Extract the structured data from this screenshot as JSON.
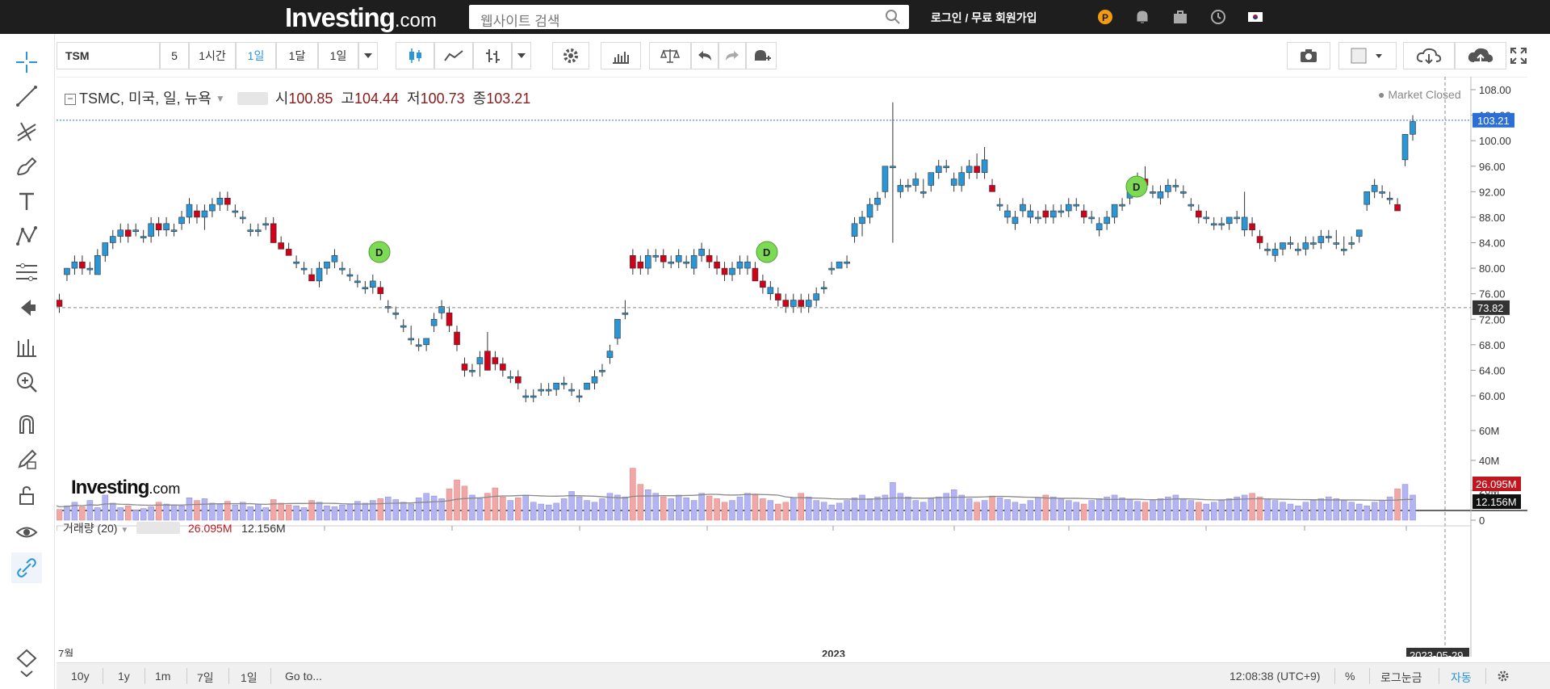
{
  "header": {
    "logo_main": "Investing",
    "logo_suffix": ".com",
    "search_placeholder": "웹사이트 검색",
    "login_text": "로그인 / 무료 회원가입",
    "icons": [
      "pro-icon",
      "bell-icon",
      "briefcase-icon",
      "clock-icon",
      "korea-flag-icon"
    ]
  },
  "left_tools": [
    "crosshair-icon",
    "trendline-icon",
    "pitchfork-icon",
    "brush-icon",
    "text-icon",
    "pattern-icon",
    "fib-icon",
    "back-arrow-icon",
    "measure-icon",
    "zoom-in-icon",
    "magnet-icon",
    "lock-pencil-icon",
    "unlock-icon",
    "eye-icon",
    "link-icon",
    "collapse-icon"
  ],
  "toolbar": {
    "symbol": "TSM",
    "intervals": [
      "5",
      "1시간",
      "1일",
      "1달",
      "1일"
    ],
    "active_interval": "1일"
  },
  "legend": {
    "title": "TSMC, 미국, 일, 뉴욕",
    "open_label": "시",
    "open": "100.85",
    "high_label": "고",
    "high": "104.44",
    "low_label": "저",
    "low": "100.73",
    "close_label": "종",
    "close": "103.21",
    "market_status": "Market Closed"
  },
  "volume_legend": {
    "label": "거래량 (20)",
    "value": "26.095M",
    "ma_value": "12.156M"
  },
  "watermark": {
    "main": "Investing",
    "suffix": ".com"
  },
  "chart_data": {
    "type": "candlestick",
    "price_axis": [
      "108.00",
      "104.00",
      "100.00",
      "96.00",
      "92.00",
      "88.00",
      "84.00",
      "80.00",
      "76.00",
      "72.00",
      "68.00",
      "64.00",
      "60.00"
    ],
    "price_badges": [
      "103.21",
      "73.82"
    ],
    "volume_axis": [
      "60M",
      "40M",
      "20M",
      "0"
    ],
    "volume_badges": [
      "26.095M",
      "12.156M"
    ],
    "x_labels": [
      "7월",
      "2023"
    ],
    "crosshair_date": "2023-05-29",
    "dividend_marker": "D",
    "candles": [
      [
        79,
        81,
        77,
        81
      ],
      [
        75,
        76,
        73,
        74
      ],
      [
        79,
        80,
        78,
        80
      ],
      [
        80,
        82,
        79,
        81
      ],
      [
        81,
        82,
        79,
        80
      ],
      [
        80,
        81,
        79,
        80
      ],
      [
        79,
        83,
        79,
        82
      ],
      [
        82,
        84,
        81,
        84
      ],
      [
        84,
        86,
        83,
        85
      ],
      [
        85,
        87,
        84,
        86
      ],
      [
        86,
        87,
        84,
        85
      ],
      [
        86,
        87,
        85,
        86
      ],
      [
        85,
        86,
        84,
        85
      ],
      [
        85,
        88,
        84,
        87
      ],
      [
        87,
        88,
        85,
        86
      ],
      [
        86,
        88,
        85,
        87
      ],
      [
        86,
        87,
        85,
        86
      ],
      [
        87,
        89,
        86,
        88
      ],
      [
        88,
        91,
        87,
        90
      ],
      [
        89,
        90,
        87,
        88
      ],
      [
        88,
        90,
        86,
        89
      ],
      [
        89,
        91,
        88,
        90
      ],
      [
        90,
        92,
        89,
        91
      ],
      [
        91,
        92,
        89,
        90
      ],
      [
        89,
        90,
        88,
        89
      ],
      [
        88,
        89,
        87,
        88
      ],
      [
        86,
        87,
        85,
        86
      ],
      [
        86,
        87,
        85,
        86
      ],
      [
        87,
        88,
        86,
        87
      ],
      [
        87,
        88,
        84,
        84
      ],
      [
        84,
        85,
        83,
        83
      ],
      [
        83,
        84,
        82,
        82
      ],
      [
        81,
        82,
        80,
        81
      ],
      [
        80,
        81,
        79,
        80
      ],
      [
        79,
        80,
        78,
        78
      ],
      [
        78,
        81,
        77,
        80
      ],
      [
        80,
        81,
        79,
        81
      ],
      [
        81,
        83,
        80,
        82
      ],
      [
        80,
        81,
        79,
        80
      ],
      [
        79,
        80,
        78,
        79
      ],
      [
        78,
        79,
        77,
        78
      ],
      [
        77,
        78,
        76,
        77
      ],
      [
        77,
        79,
        76,
        78
      ],
      [
        77,
        78,
        75,
        76
      ],
      [
        74,
        75,
        73,
        74
      ],
      [
        73,
        74,
        72,
        73
      ],
      [
        71,
        72,
        70,
        71
      ],
      [
        69,
        71,
        68,
        69
      ],
      [
        68,
        69,
        67,
        68
      ],
      [
        68,
        69,
        67,
        69
      ],
      [
        71,
        73,
        70,
        72
      ],
      [
        73,
        75,
        72,
        74
      ],
      [
        73,
        74,
        70,
        71
      ],
      [
        70,
        71,
        67,
        68
      ],
      [
        65,
        66,
        63,
        64
      ],
      [
        64,
        65,
        63,
        64
      ],
      [
        65,
        67,
        63,
        66
      ],
      [
        67,
        70,
        64,
        64
      ],
      [
        66,
        67,
        64,
        65
      ],
      [
        65,
        66,
        63,
        64
      ],
      [
        63,
        64,
        62,
        63
      ],
      [
        63,
        64,
        61,
        62
      ],
      [
        60,
        61,
        59,
        60
      ],
      [
        60,
        61,
        59,
        60
      ],
      [
        61,
        62,
        60,
        61
      ],
      [
        61,
        62,
        60,
        61
      ],
      [
        61,
        62,
        60,
        62
      ],
      [
        62,
        63,
        61,
        62
      ],
      [
        61,
        62,
        60,
        61
      ],
      [
        60,
        61,
        59,
        60
      ],
      [
        61,
        62,
        61,
        62
      ],
      [
        62,
        64,
        61,
        63
      ],
      [
        64,
        65,
        63,
        64
      ],
      [
        66,
        68,
        65,
        67
      ],
      [
        69,
        72,
        68,
        72
      ],
      [
        73,
        75,
        72,
        73
      ],
      [
        82,
        83,
        79,
        80
      ],
      [
        81,
        82,
        79,
        80
      ],
      [
        80,
        83,
        79,
        82
      ],
      [
        82,
        83,
        81,
        82
      ],
      [
        82,
        83,
        80,
        81
      ],
      [
        81,
        82,
        80,
        81
      ],
      [
        81,
        83,
        80,
        82
      ],
      [
        81,
        82,
        80,
        81
      ],
      [
        80,
        83,
        79,
        82
      ],
      [
        82,
        84,
        81,
        83
      ],
      [
        82,
        83,
        80,
        81
      ],
      [
        81,
        82,
        79,
        80
      ],
      [
        80,
        81,
        78,
        79
      ],
      [
        79,
        81,
        78,
        80
      ],
      [
        80,
        82,
        79,
        81
      ],
      [
        80,
        82,
        79,
        81
      ],
      [
        80,
        81,
        78,
        78
      ],
      [
        78,
        79,
        76,
        77
      ],
      [
        76,
        78,
        75,
        77
      ],
      [
        76,
        77,
        74,
        75
      ],
      [
        75,
        76,
        73,
        74
      ],
      [
        74,
        76,
        73,
        75
      ],
      [
        75,
        76,
        73,
        74
      ],
      [
        74,
        76,
        73,
        75
      ],
      [
        75,
        77,
        74,
        76
      ],
      [
        77,
        78,
        76,
        77
      ],
      [
        80,
        81,
        79,
        80
      ],
      [
        80,
        81,
        80,
        81
      ],
      [
        81,
        82,
        80,
        81
      ],
      [
        85,
        88,
        84,
        87
      ],
      [
        87,
        89,
        85,
        88
      ],
      [
        88,
        91,
        87,
        90
      ],
      [
        90,
        92,
        89,
        91
      ],
      [
        92,
        95,
        91,
        96
      ],
      [
        96,
        106,
        84,
        96
      ],
      [
        92,
        94,
        91,
        93
      ],
      [
        93,
        94,
        92,
        93
      ],
      [
        93,
        95,
        92,
        94
      ],
      [
        92,
        94,
        91,
        92
      ],
      [
        93,
        95,
        92,
        95
      ],
      [
        95,
        97,
        94,
        96
      ],
      [
        96,
        97,
        95,
        96
      ],
      [
        93,
        95,
        92,
        94
      ],
      [
        93,
        96,
        92,
        95
      ],
      [
        95,
        97,
        94,
        96
      ],
      [
        96,
        98,
        94,
        95
      ],
      [
        95,
        99,
        94,
        97
      ],
      [
        93,
        94,
        92,
        92
      ],
      [
        90,
        91,
        89,
        90
      ],
      [
        88,
        90,
        87,
        89
      ],
      [
        87,
        89,
        86,
        88
      ],
      [
        89,
        91,
        88,
        90
      ],
      [
        88,
        90,
        87,
        89
      ],
      [
        88,
        89,
        87,
        88
      ],
      [
        89,
        90,
        87,
        88
      ],
      [
        88,
        90,
        87,
        89
      ],
      [
        89,
        90,
        88,
        89
      ],
      [
        89,
        91,
        88,
        90
      ],
      [
        90,
        91,
        89,
        90
      ],
      [
        89,
        90,
        87,
        88
      ],
      [
        88,
        89,
        87,
        88
      ],
      [
        86,
        88,
        85,
        87
      ],
      [
        87,
        89,
        86,
        88
      ],
      [
        88,
        90,
        87,
        90
      ],
      [
        90,
        91,
        89,
        90
      ],
      [
        91,
        93,
        90,
        92
      ],
      [
        93,
        95,
        92,
        94
      ],
      [
        94,
        96,
        92,
        93
      ],
      [
        92,
        93,
        91,
        92
      ],
      [
        91,
        93,
        90,
        92
      ],
      [
        92,
        94,
        91,
        93
      ],
      [
        93,
        94,
        92,
        93
      ],
      [
        92,
        93,
        91,
        92
      ],
      [
        90,
        91,
        89,
        90
      ],
      [
        89,
        90,
        87,
        88
      ],
      [
        88,
        89,
        87,
        88
      ],
      [
        87,
        88,
        86,
        87
      ],
      [
        87,
        88,
        86,
        87
      ],
      [
        87,
        88,
        86,
        88
      ],
      [
        88,
        89,
        87,
        88
      ],
      [
        86,
        92,
        85,
        88
      ],
      [
        87,
        88,
        85,
        86
      ],
      [
        85,
        86,
        83,
        84
      ],
      [
        83,
        84,
        82,
        83
      ],
      [
        82,
        84,
        81,
        83
      ],
      [
        83,
        84,
        82,
        84
      ],
      [
        84,
        85,
        83,
        84
      ],
      [
        83,
        84,
        82,
        83
      ],
      [
        83,
        85,
        82,
        84
      ],
      [
        84,
        85,
        83,
        84
      ],
      [
        84,
        86,
        83,
        85
      ],
      [
        85,
        86,
        84,
        85
      ],
      [
        84,
        86,
        83,
        84
      ],
      [
        83,
        85,
        82,
        83
      ],
      [
        84,
        85,
        83,
        84
      ],
      [
        85,
        86,
        84,
        86
      ],
      [
        90,
        92,
        89,
        92
      ],
      [
        92,
        94,
        91,
        93
      ],
      [
        92,
        93,
        91,
        92
      ],
      [
        91,
        92,
        90,
        91
      ],
      [
        90,
        91,
        89,
        89
      ],
      [
        97,
        100,
        96,
        101
      ],
      [
        101,
        104,
        100,
        103
      ]
    ],
    "volume_pct": [
      18,
      12,
      16,
      20,
      15,
      22,
      14,
      28,
      19,
      14,
      16,
      11,
      13,
      15,
      20,
      18,
      17,
      16,
      25,
      22,
      24,
      19,
      18,
      21,
      17,
      20,
      15,
      18,
      14,
      23,
      19,
      17,
      16,
      14,
      22,
      20,
      16,
      15,
      17,
      18,
      21,
      19,
      22,
      24,
      26,
      23,
      20,
      18,
      25,
      30,
      27,
      24,
      35,
      45,
      38,
      28,
      24,
      30,
      36,
      26,
      22,
      25,
      28,
      20,
      18,
      17,
      19,
      24,
      32,
      26,
      22,
      20,
      24,
      30,
      28,
      26,
      58,
      40,
      34,
      30,
      26,
      24,
      28,
      25,
      22,
      30,
      27,
      24,
      20,
      22,
      26,
      30,
      28,
      24,
      22,
      18,
      20,
      25,
      30,
      26,
      22,
      20,
      17,
      19,
      22,
      25,
      28,
      24,
      26,
      28,
      42,
      30,
      26,
      22,
      20,
      24,
      26,
      30,
      34,
      28,
      24,
      20,
      22,
      27,
      25,
      23,
      20,
      18,
      22,
      25,
      28,
      26,
      24,
      22,
      20,
      18,
      22,
      24,
      26,
      28,
      25,
      23,
      21,
      20,
      22,
      24,
      26,
      28,
      24,
      22,
      20,
      18,
      20,
      22,
      24,
      26,
      28,
      30,
      26,
      24,
      22,
      20,
      18,
      16,
      20,
      22,
      24,
      26,
      24,
      22,
      20,
      18,
      16,
      20,
      22,
      26,
      35,
      40,
      28,
      70,
      34
    ],
    "ma_pct": 18
  },
  "bottom_bar": {
    "ranges": [
      "10y",
      "1y",
      "1m",
      "7일",
      "1일"
    ],
    "goto": "Go to...",
    "time": "12:08:38 (UTC+9)",
    "percent": "%",
    "log": "로그눈금",
    "auto": "자동"
  }
}
